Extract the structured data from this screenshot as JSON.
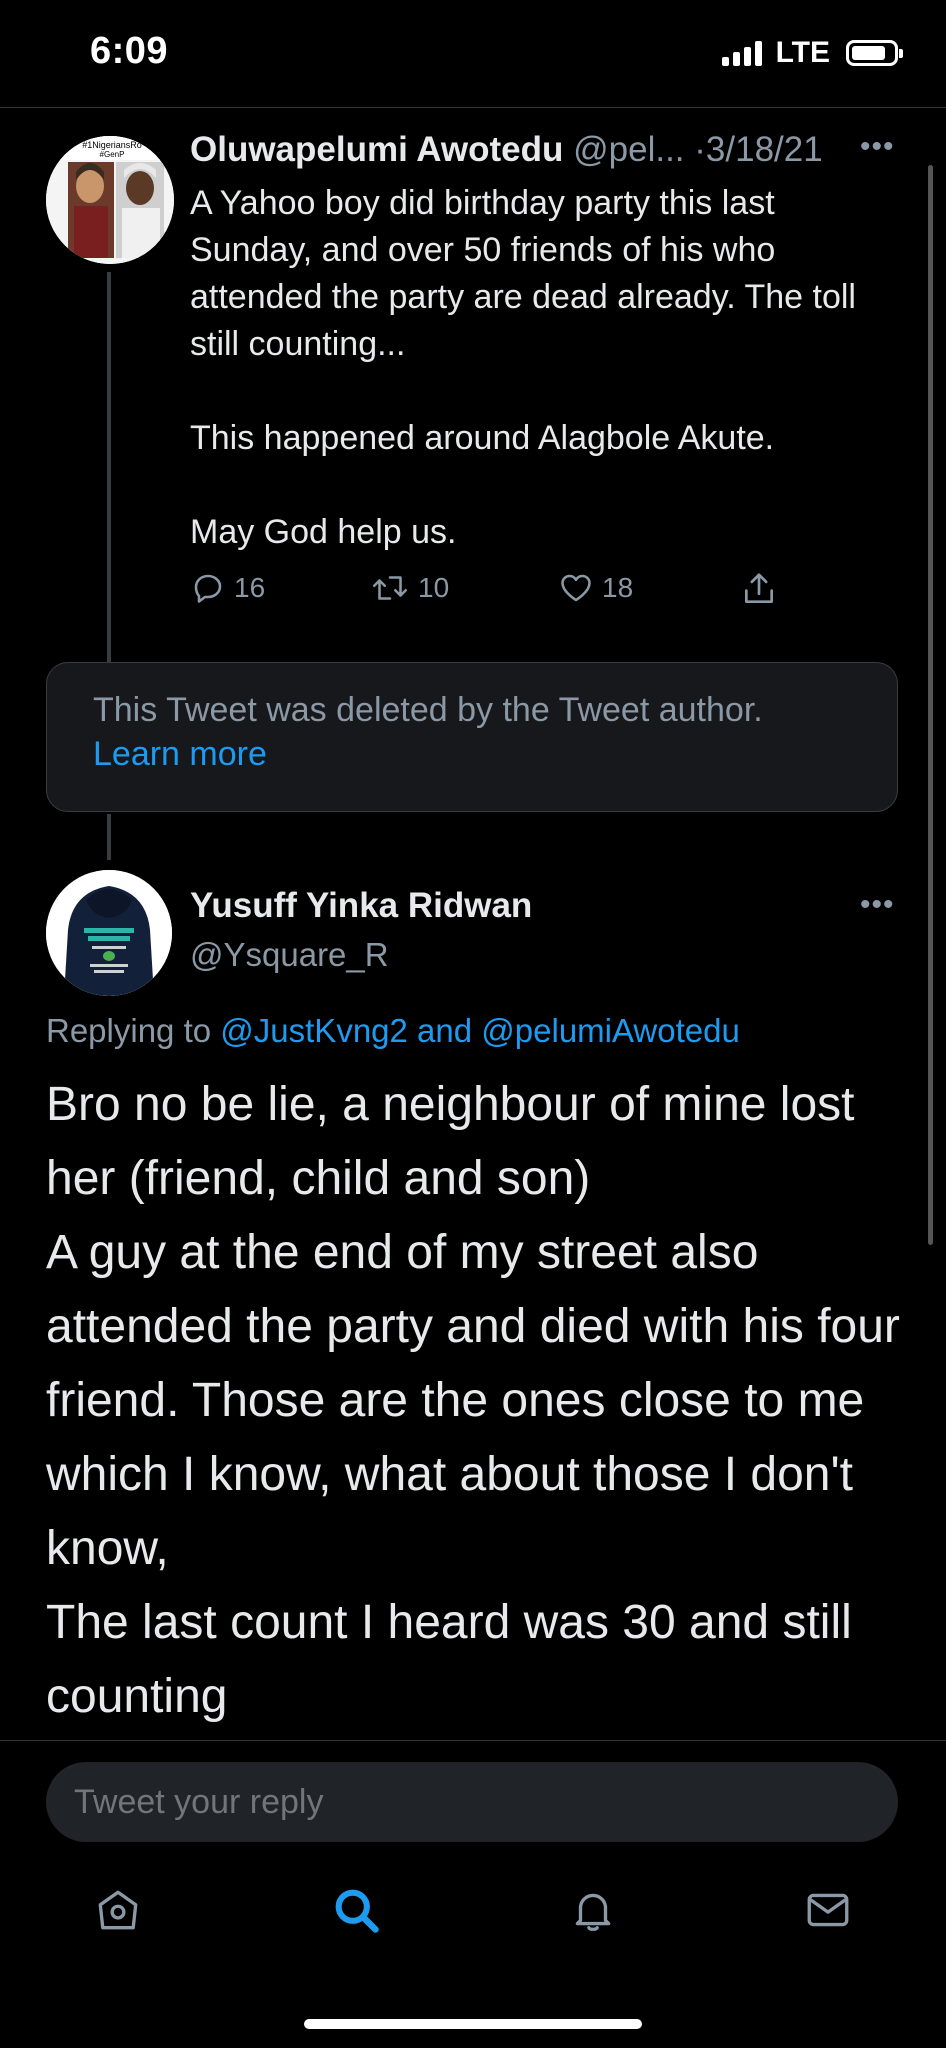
{
  "status_bar": {
    "time": "6:09",
    "network": "LTE"
  },
  "tweet1": {
    "author_name": "Oluwapelumi Awotedu",
    "handle": "@pel...",
    "separator": "·",
    "date": "3/18/21",
    "avatar_text": [
      "#1NigeriansRo",
      "#GenP"
    ],
    "body": [
      "A Yahoo boy did birthday party this last Sunday, and over 50 friends of his who attended the party are dead already. The toll still counting...",
      "This happened around Alagbole Akute.",
      "May God help us."
    ],
    "reply_count": "16",
    "retweet_count": "10",
    "like_count": "18"
  },
  "deleted_tweet": {
    "message": "This Tweet was deleted by the Tweet author.",
    "learn_more": "Learn more"
  },
  "tweet2": {
    "author_name": "Yusuff Yinka Ridwan",
    "handle": "@Ysquare_R",
    "replying_prefix": "Replying to",
    "replying_user1": "@JustKvng2",
    "replying_and": "and",
    "replying_user2": "@pelumiAwotedu",
    "body": [
      "Bro no be lie, a neighbour of mine lost her (friend, child and son)",
      "A guy at the end of my street also attended the party and died with his four friend. Those are the ones close to me which I know, what about those I don't know,",
      "The last count I heard was 30 and still counting"
    ]
  },
  "reply_box": {
    "placeholder": "Tweet your reply"
  },
  "tab_bar": {
    "items": [
      {
        "icon": "home-icon",
        "active": false
      },
      {
        "icon": "search-icon",
        "active": true
      },
      {
        "icon": "bell-icon",
        "active": false
      },
      {
        "icon": "mail-icon",
        "active": false
      }
    ]
  },
  "colors": {
    "background": "#000000",
    "link": "#1d9bf0",
    "muted_text": "#8b98a5",
    "card_background": "#16181c",
    "input_background": "#202327"
  }
}
